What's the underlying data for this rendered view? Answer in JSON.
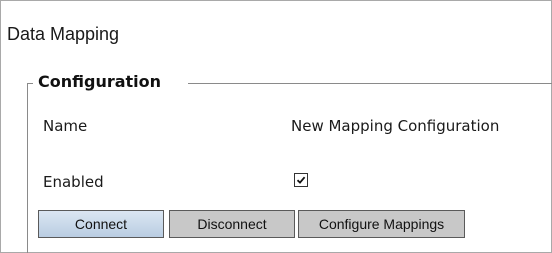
{
  "panel": {
    "title": "Data Mapping"
  },
  "configuration": {
    "legend": "Configuration",
    "name_label": "Name",
    "name_value": "New Mapping Configuration",
    "enabled_label": "Enabled",
    "enabled_checked": true
  },
  "buttons": {
    "connect": "Connect",
    "disconnect": "Disconnect",
    "configure_mappings": "Configure Mappings"
  },
  "colors": {
    "connect_button_bg": "#c6d6e8",
    "secondary_button_bg": "#c8c8c8",
    "border": "#8a8a8a"
  }
}
